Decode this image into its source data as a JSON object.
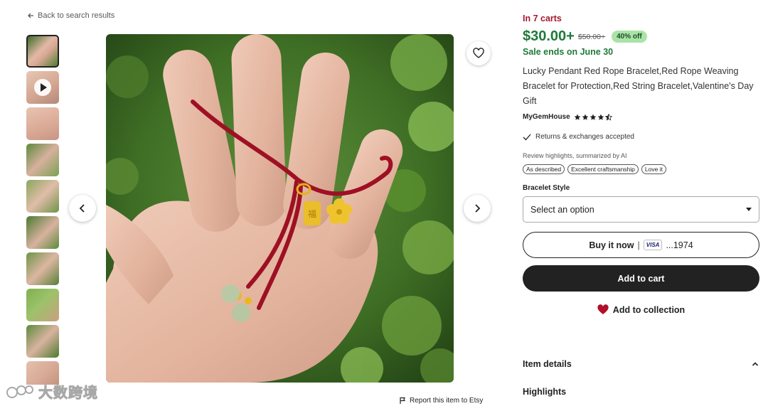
{
  "nav": {
    "back_label": "Back to search results"
  },
  "gallery": {
    "thumbnail_count": 10,
    "active_thumbnail": 1,
    "video_thumbnail": 2
  },
  "listing": {
    "in_carts": "In 7 carts",
    "price": "$30.00+",
    "original_price": "$50.00+",
    "discount": "40% off",
    "sale_note": "Sale ends on June 30",
    "title": "Lucky Pendant Red Rope Bracelet,Red Rope Weaving Bracelet for Protection,Red String Bracelet,Valentine's Day Gift",
    "shop_name": "MyGemHouse",
    "rating": 4.5,
    "returns": "Returns & exchanges accepted",
    "review_highlights_title": "Review highlights, summarized by AI",
    "review_chips": [
      "As described",
      "Excellent craftsmanship",
      "Love it"
    ]
  },
  "options": {
    "style_label": "Bracelet Style",
    "style_value": "Select an option"
  },
  "actions": {
    "buy_now_label": "Buy it now",
    "buy_now_sep": "|",
    "card_brand": "VISA",
    "card_number": "...1974",
    "add_to_cart": "Add to cart",
    "add_to_collection": "Add to collection"
  },
  "sections": {
    "item_details": "Item details",
    "highlights": "Highlights"
  },
  "footer": {
    "report_label": "Report this item to Etsy",
    "watermark_text": "大数跨境"
  },
  "colors": {
    "in_carts": "#a61a2e",
    "price": "#1f7a3a",
    "discount_badge": "#a9e4a6",
    "primary_button": "#222222",
    "heart": "#b1102a"
  }
}
